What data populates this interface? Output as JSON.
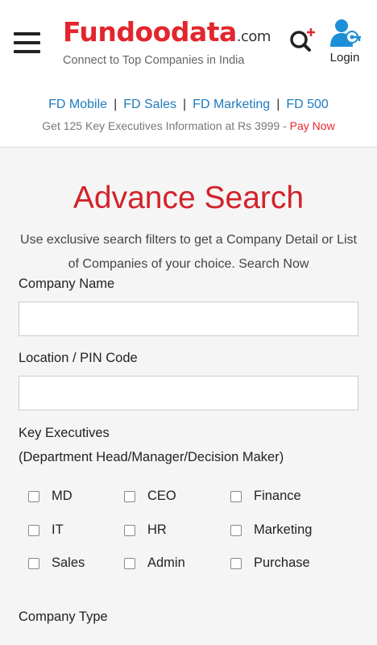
{
  "header": {
    "brand": "Fundoodata",
    "brand_suffix": ".com",
    "tagline": "Connect to Top Companies in India",
    "login_label": "Login"
  },
  "links": {
    "items": [
      "FD Mobile",
      "FD Sales",
      "FD Marketing",
      "FD 500"
    ],
    "separator": "|"
  },
  "offer": {
    "text": "Get 125 Key Executives Information at Rs 3999 - ",
    "cta": "Pay Now"
  },
  "main": {
    "title": "Advance Search",
    "intro": "Use exclusive search filters to get a Company Detail or List of Companies of your choice. Search Now",
    "company_name_label": "Company Name",
    "company_name_value": "",
    "location_label": "Location / PIN Code",
    "location_value": "",
    "key_exec_label": "Key Executives",
    "key_exec_sublabel": "(Department Head/Manager/Decision Maker)",
    "executives": [
      "MD",
      "CEO",
      "Finance",
      "IT",
      "HR",
      "Marketing",
      "Sales",
      "Admin",
      "Purchase"
    ],
    "company_type_label": "Company Type"
  },
  "colors": {
    "brand_red": "#e3262d",
    "link_blue": "#1f7bbd"
  }
}
